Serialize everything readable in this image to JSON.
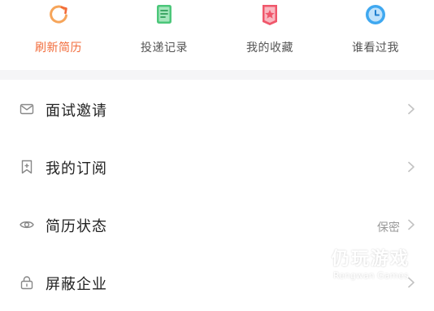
{
  "colors": {
    "accent": "#f26b3a",
    "green": "#4cc77a",
    "red": "#f0576b",
    "blue": "#3fa8f0",
    "text_primary": "#222222",
    "text_secondary": "#555555",
    "text_muted": "#999999",
    "divider_gap": "#f5f5f7"
  },
  "quick_actions": [
    {
      "label": "刷新简历",
      "icon": "refresh-icon",
      "active": true
    },
    {
      "label": "投递记录",
      "icon": "document-icon",
      "active": false
    },
    {
      "label": "我的收藏",
      "icon": "favorite-star-icon",
      "active": false
    },
    {
      "label": "谁看过我",
      "icon": "clock-icon",
      "active": false
    }
  ],
  "menu": {
    "items": [
      {
        "label": "面试邀请",
        "icon": "mail-icon",
        "value": ""
      },
      {
        "label": "我的订阅",
        "icon": "bookmark-icon",
        "value": ""
      },
      {
        "label": "简历状态",
        "icon": "eye-icon",
        "value": "保密"
      },
      {
        "label": "屏蔽企业",
        "icon": "lock-icon",
        "value": ""
      }
    ]
  },
  "watermark": {
    "title": "仍玩游戏",
    "subtitle": "Rengwan Games"
  }
}
